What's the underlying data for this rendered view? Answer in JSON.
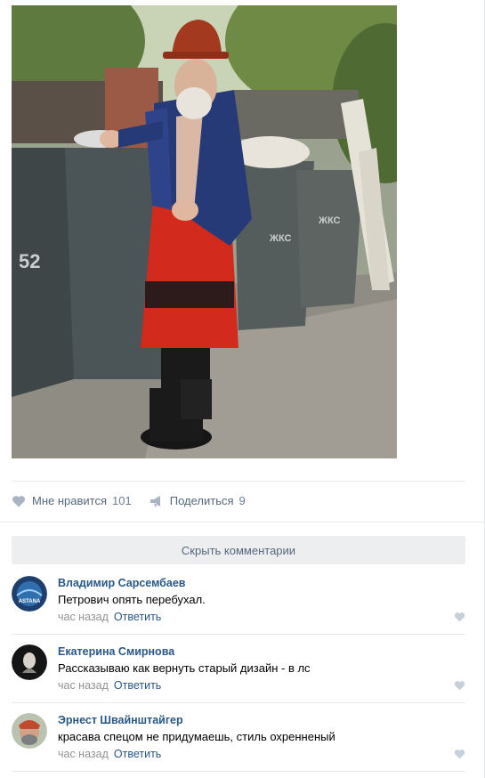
{
  "post": {
    "photo_icon": "photo-image",
    "likes": {
      "label": "Мне нравится",
      "count": "101",
      "icon": "heart-icon"
    },
    "share": {
      "label": "Поделиться",
      "count": "9",
      "icon": "megaphone-icon"
    }
  },
  "comments_section": {
    "hide_label": "Скрыть комментарии",
    "items": [
      {
        "author": "Владимир Сарсембаев",
        "text": "Петрович опять перебухал.",
        "time": "час назад",
        "reply": "Ответить",
        "avatar_text": "ASTANA"
      },
      {
        "author": "Екатерина Смирнова",
        "text": "Рассказываю как вернуть старый дизайн - в лс",
        "time": "час назад",
        "reply": "Ответить"
      },
      {
        "author": "Эрнест Швайнштайгер",
        "text": "красава спецом не придумаешь, стиль охренненый",
        "time": "час назад",
        "reply": "Ответить"
      }
    ]
  },
  "colors": {
    "link": "#2a5885",
    "muted": "#939393",
    "accent_grey": "#828a99",
    "button_bg": "#edeef0"
  }
}
